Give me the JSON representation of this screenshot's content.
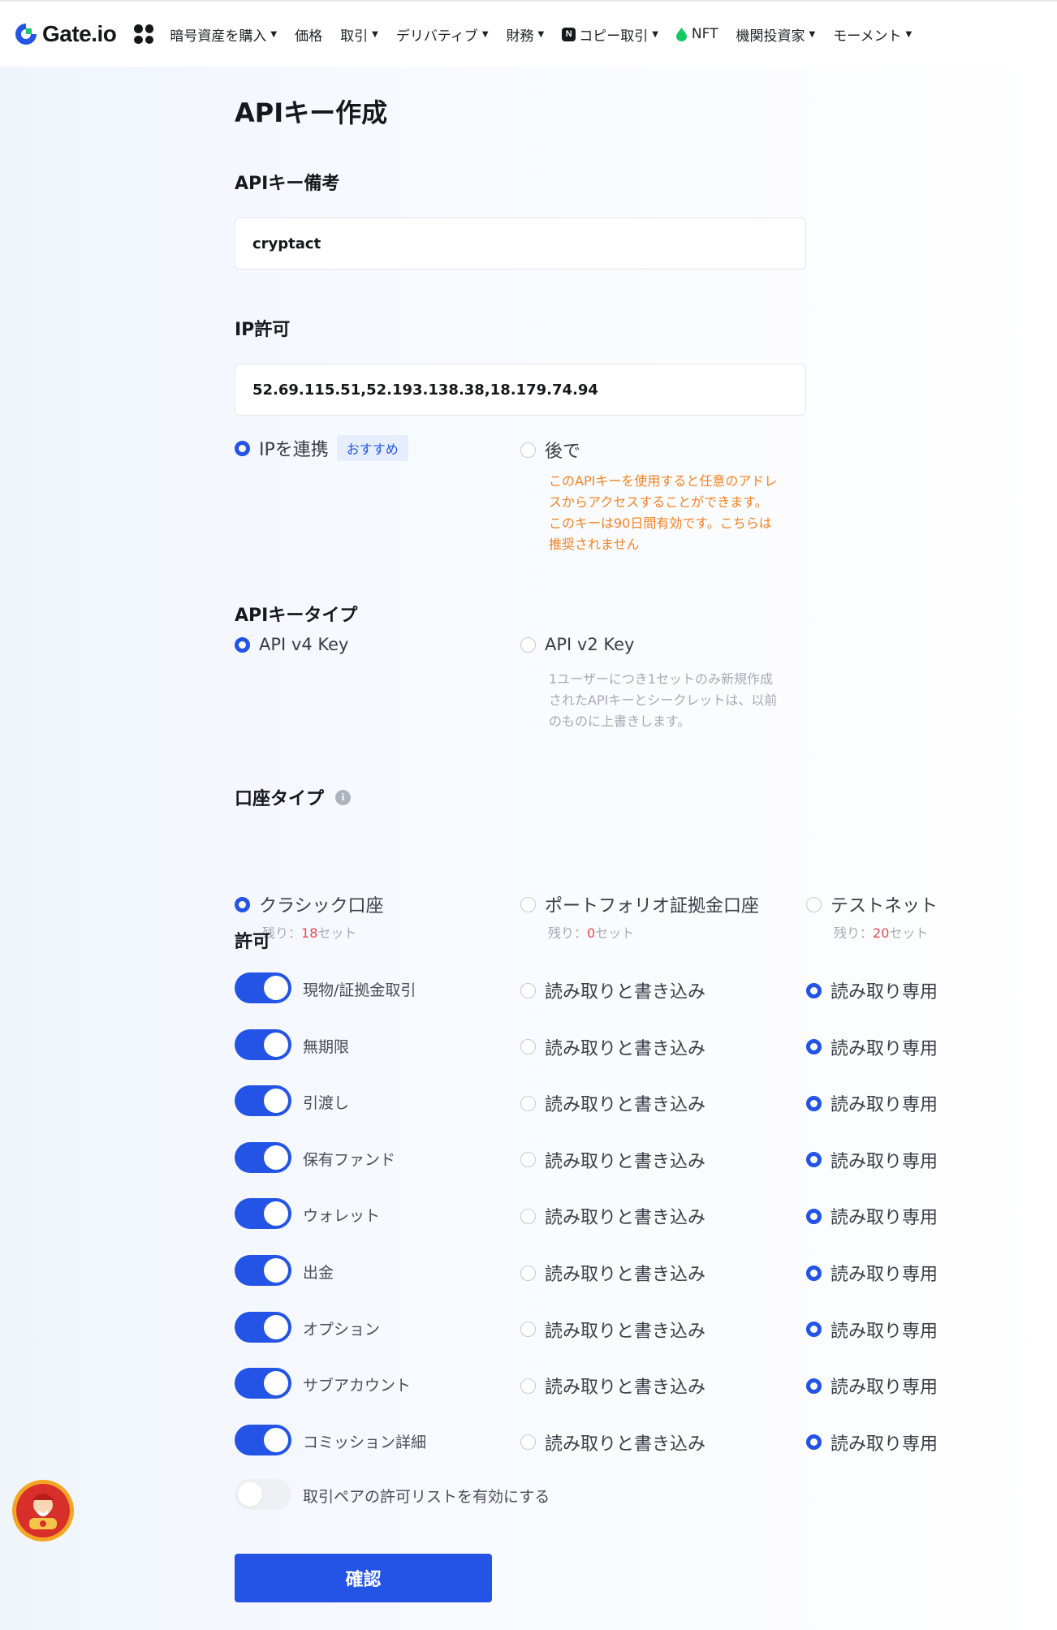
{
  "nav": {
    "logo_text": "Gate.io",
    "items": [
      {
        "label": "暗号資産を購入",
        "caret": true
      },
      {
        "label": "価格",
        "caret": false
      },
      {
        "label": "取引",
        "caret": true
      },
      {
        "label": "デリバティブ",
        "caret": true
      },
      {
        "label": "財務",
        "caret": true
      },
      {
        "label": "コピー取引",
        "caret": true
      },
      {
        "label": "NFT",
        "caret": false
      },
      {
        "label": "機関投資家",
        "caret": true
      },
      {
        "label": "モーメント",
        "caret": true
      }
    ],
    "copy_icon_letter": "N"
  },
  "page": {
    "title": "APIキー作成"
  },
  "remark": {
    "label": "APIキー備考",
    "value": "cryptact"
  },
  "ip": {
    "label": "IP許可",
    "value": "52.69.115.51,52.193.138.38,18.179.74.94",
    "options": [
      {
        "label": "IPを連携",
        "badge": "おすすめ",
        "selected": true
      },
      {
        "label": "後で",
        "selected": false
      }
    ],
    "later_warning_lines": [
      "このAPIキーを使用すると任意のアドレ",
      "スからアクセスすることができます。",
      "このキーは90日間有効です。こちらは",
      "推奨されません"
    ]
  },
  "key_type": {
    "label": "APIキータイプ",
    "options": [
      {
        "label": "API v4 Key",
        "selected": true
      },
      {
        "label": "API v2 Key",
        "selected": false
      }
    ],
    "v2_note_lines": [
      "1ユーザーにつき1セットのみ新規作成",
      "されたAPIキーとシークレットは、以前",
      "のものに上書きします。"
    ]
  },
  "account_type": {
    "label": "口座タイプ",
    "info_icon": "i",
    "remain_prefix": "残り：",
    "remain_suffix": "セット",
    "options": [
      {
        "label": "クラシック口座",
        "remaining": "18",
        "selected": true
      },
      {
        "label": "ポートフォリオ証拠金口座",
        "remaining": "0",
        "selected": false
      },
      {
        "label": "テストネット",
        "remaining": "20",
        "selected": false
      }
    ]
  },
  "permissions": {
    "label": "許可",
    "rw_label": "読み取りと書き込み",
    "ro_label": "読み取り専用",
    "items": [
      {
        "label": "現物/証拠金取引",
        "enabled": true,
        "mode": "read-only"
      },
      {
        "label": "無期限",
        "enabled": true,
        "mode": "read-only"
      },
      {
        "label": "引渡し",
        "enabled": true,
        "mode": "read-only"
      },
      {
        "label": "保有ファンド",
        "enabled": true,
        "mode": "read-only"
      },
      {
        "label": "ウォレット",
        "enabled": true,
        "mode": "read-only"
      },
      {
        "label": "出金",
        "enabled": true,
        "mode": "read-only"
      },
      {
        "label": "オプション",
        "enabled": true,
        "mode": "read-only"
      },
      {
        "label": "サブアカウント",
        "enabled": true,
        "mode": "read-only"
      },
      {
        "label": "コミッション詳細",
        "enabled": true,
        "mode": "read-only"
      }
    ],
    "whitelist": {
      "label": "取引ペアの許可リストを有効にする",
      "enabled": false
    }
  },
  "confirm_label": "確認",
  "colors": {
    "accent": "#2354e6",
    "warning": "#f5821f",
    "remaining_number": "#e8484c"
  }
}
